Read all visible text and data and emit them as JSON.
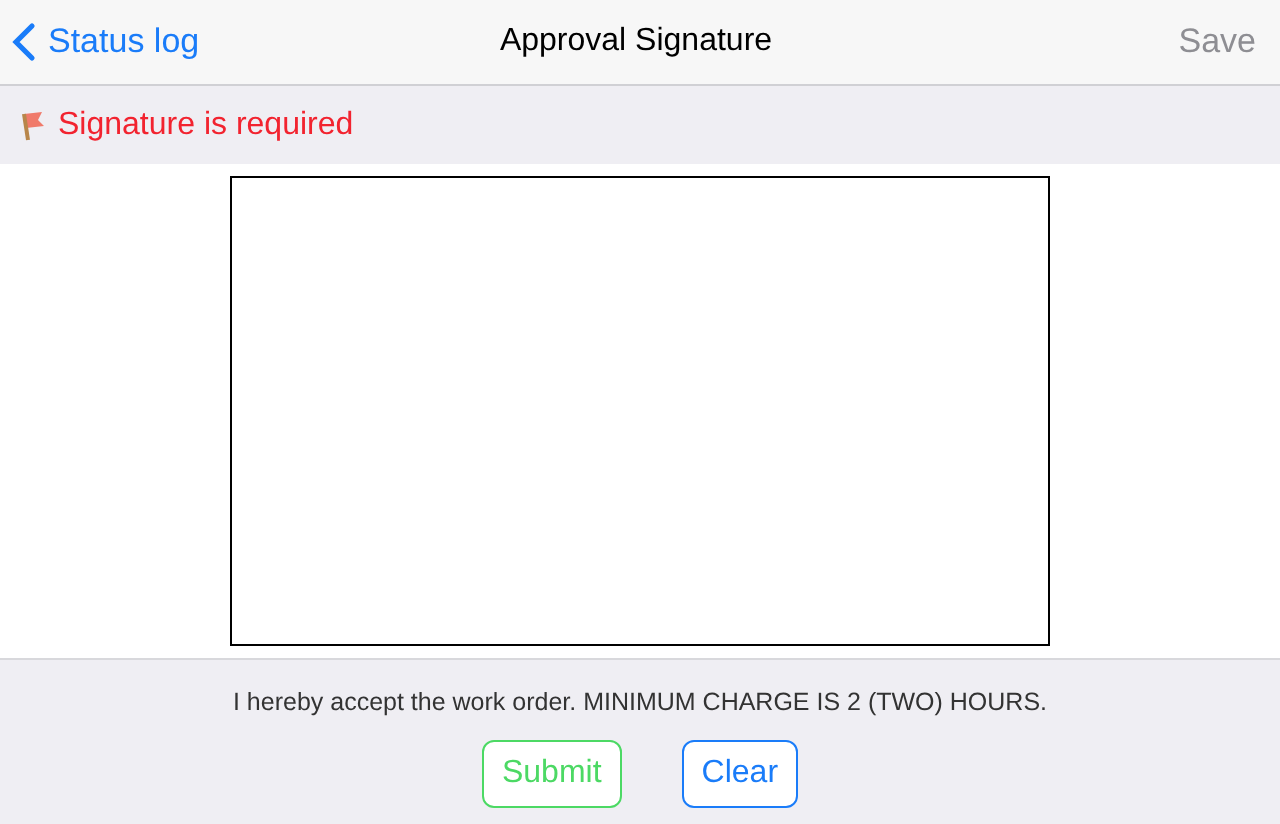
{
  "nav": {
    "back": "Status log",
    "title": "Approval Signature",
    "action": {
      "label": "Save",
      "disabled": true
    }
  },
  "alert": {
    "text": "Signature is required"
  },
  "footer": {
    "text": "I hereby accept the work order. MINIMUM CHARGE IS 2 (TWO) HOURS.",
    "buttons": [
      {
        "label": "Submit",
        "color": "#4cd964"
      },
      {
        "label": "Clear",
        "color": "#1a7cf9"
      }
    ]
  }
}
